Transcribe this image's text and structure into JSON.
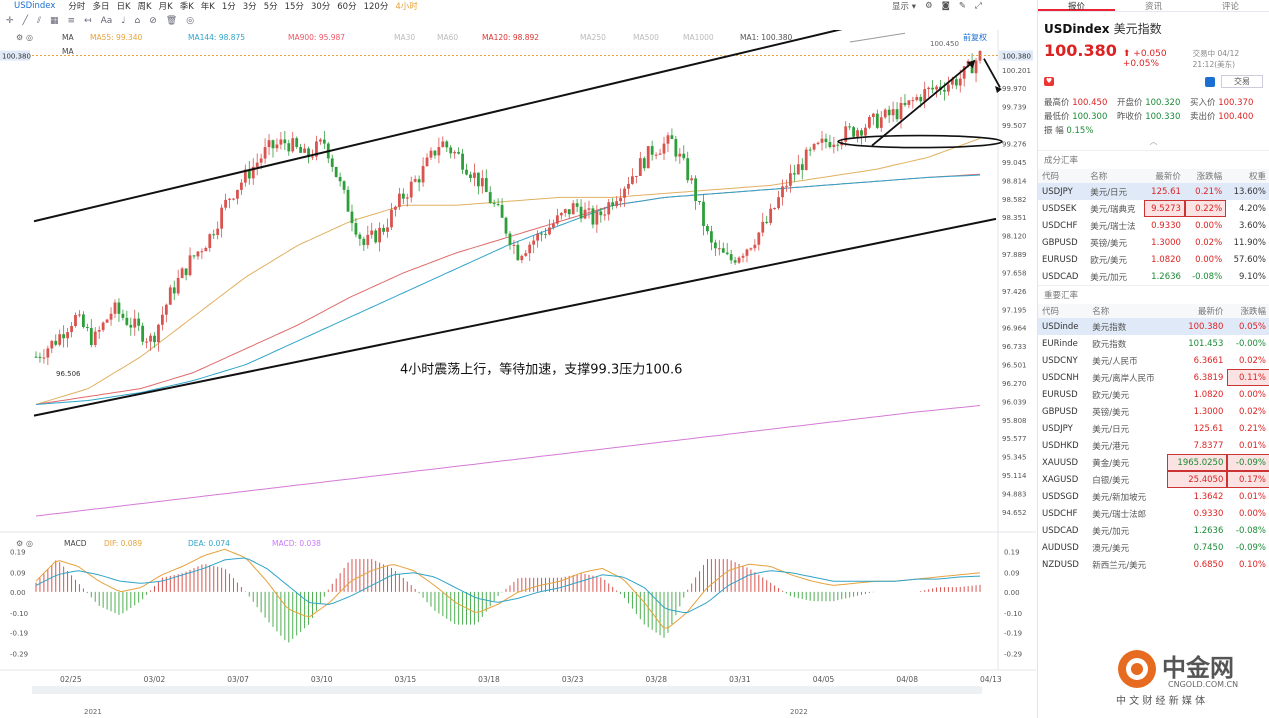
{
  "topbar": {
    "symbol": "USDindex",
    "intervals": [
      "分时",
      "多日",
      "日K",
      "周K",
      "月K",
      "季K",
      "年K",
      "1分",
      "3分",
      "5分",
      "15分",
      "30分",
      "60分",
      "120分",
      "4小时"
    ],
    "active": "4小时",
    "right": [
      "显示 ▾"
    ]
  },
  "ma_legend": {
    "label": "MA",
    "items": [
      {
        "name": "MA55: 99.340",
        "color": "#e6a23c"
      },
      {
        "name": "MA144: 98.875",
        "color": "#2fa4c9"
      },
      {
        "name": "MA900: 95.987",
        "color": "#e56"
      },
      {
        "name": "MA30",
        "color": "#bbb"
      },
      {
        "name": "MA60",
        "color": "#bbb"
      },
      {
        "name": "MA120: 98.892",
        "color": "#d33"
      },
      {
        "name": "MA250",
        "color": "#bbb"
      },
      {
        "name": "MA500",
        "color": "#bbb"
      },
      {
        "name": "MA1000",
        "color": "#bbb"
      },
      {
        "name": "MA1: 100.380",
        "color": "#555"
      }
    ],
    "restore": "前复权",
    "second_ma": "MA"
  },
  "macd_legend": {
    "label": "MACD",
    "items": [
      {
        "name": "DIF: 0.089",
        "color": "#e6a23c"
      },
      {
        "name": "DEA: 0.074",
        "color": "#2fa4c9"
      },
      {
        "name": "MACD: 0.038",
        "color": "#c7f"
      }
    ]
  },
  "annotation": "4小时震荡上行，等待加速，支撑99.3压力100.6",
  "chart_data": {
    "type": "candlestick",
    "y_ticks": [
      100.201,
      99.97,
      99.739,
      99.507,
      99.276,
      99.045,
      98.814,
      98.582,
      98.351,
      98.12,
      97.889,
      97.658,
      97.426,
      97.195,
      96.964,
      96.733,
      96.501,
      96.27,
      96.039,
      95.808,
      95.577,
      95.345,
      95.114,
      94.883,
      94.652
    ],
    "ylim": [
      94.55,
      100.55
    ],
    "last_price": 100.38,
    "high_label": 100.45,
    "low_label": 96.506,
    "x_ticks": [
      "02/25",
      "03/02",
      "03/07",
      "03/10",
      "03/15",
      "03/18",
      "03/23",
      "03/28",
      "03/31",
      "04/05",
      "04/08",
      "04/13"
    ],
    "close_path": [
      96.6,
      96.8,
      97.1,
      96.8,
      97.2,
      97.0,
      96.8,
      97.4,
      97.8,
      98.1,
      98.6,
      98.9,
      99.2,
      99.3,
      99.1,
      99.3,
      98.6,
      98.0,
      98.2,
      98.6,
      98.9,
      99.3,
      99.1,
      98.8,
      98.4,
      97.9,
      98.1,
      98.3,
      98.5,
      98.3,
      98.6,
      98.9,
      99.2,
      99.3,
      98.8,
      98.0,
      97.8,
      98.0,
      98.3,
      98.8,
      99.1,
      99.3,
      99.4,
      99.5,
      99.6,
      99.7,
      99.9,
      100.0,
      100.1,
      100.38
    ],
    "macd": {
      "ylim": [
        -0.32,
        0.22
      ],
      "y_ticks": [
        0.19,
        0.09,
        0.0,
        -0.1,
        -0.19,
        -0.29
      ],
      "dif": [
        0.05,
        0.15,
        0.12,
        0.05,
        0.0,
        0.02,
        0.08,
        0.12,
        0.17,
        0.2,
        0.16,
        0.05,
        -0.08,
        -0.12,
        -0.05,
        0.05,
        0.1,
        0.13,
        0.1,
        0.03,
        -0.05,
        -0.1,
        -0.06,
        0.0,
        0.03,
        0.05,
        0.09,
        0.11,
        0.06,
        -0.05,
        -0.18,
        -0.1,
        0.02,
        0.1,
        0.13,
        0.12,
        0.08,
        0.05,
        0.03,
        0.04,
        0.05,
        0.05,
        0.06,
        0.07,
        0.08,
        0.089
      ],
      "dea": [
        0.03,
        0.08,
        0.1,
        0.08,
        0.05,
        0.04,
        0.05,
        0.08,
        0.11,
        0.15,
        0.16,
        0.11,
        0.03,
        -0.05,
        -0.06,
        -0.02,
        0.03,
        0.08,
        0.09,
        0.07,
        0.02,
        -0.03,
        -0.05,
        -0.03,
        0.0,
        0.02,
        0.05,
        0.08,
        0.07,
        0.02,
        -0.08,
        -0.1,
        -0.05,
        0.03,
        0.08,
        0.1,
        0.09,
        0.07,
        0.05,
        0.05,
        0.05,
        0.05,
        0.06,
        0.06,
        0.07,
        0.074
      ]
    },
    "dates_bottom": [
      "2021",
      "2022"
    ]
  },
  "panel": {
    "tabs": [
      "报价",
      "资讯",
      "评论"
    ],
    "symbol": "USDindex",
    "name": "美元指数",
    "price": "100.380",
    "change": "+0.050",
    "pct": "+0.05%",
    "time": "交易中 04/12 21:12(美东)",
    "btn": "交易",
    "stats": [
      [
        "最高价",
        "100.450",
        "r"
      ],
      [
        "开盘价",
        "100.320",
        ""
      ],
      [
        "买入价",
        "100.370",
        "r"
      ],
      [
        "最低价",
        "100.300",
        ""
      ],
      [
        "昨收价",
        "100.330",
        ""
      ],
      [
        "卖出价",
        "100.400",
        "r"
      ],
      [
        "振 幅",
        "0.15%",
        ""
      ]
    ],
    "sec1": "成分汇率",
    "head1": [
      "代码",
      "名称",
      "最新价",
      "涨跌幅",
      "权重"
    ],
    "rows1": [
      [
        "USDJPY",
        "美元/日元",
        "125.61",
        "0.21%",
        "13.60%"
      ],
      [
        "USDSEK",
        "美元/瑞典克",
        "9.5273",
        "0.22%",
        "4.20%"
      ],
      [
        "USDCHF",
        "美元/瑞士法",
        "0.9330",
        "0.00%",
        "3.60%"
      ],
      [
        "GBPUSD",
        "英镑/美元",
        "1.3000",
        "0.02%",
        "11.90%"
      ],
      [
        "EURUSD",
        "欧元/美元",
        "1.0820",
        "0.00%",
        "57.60%"
      ],
      [
        "USDCAD",
        "美元/加元",
        "1.2636",
        "-0.08%",
        "9.10%"
      ]
    ],
    "sec2": "重要汇率",
    "head2": [
      "代码",
      "名称",
      "最新价",
      "涨跌幅"
    ],
    "rows2": [
      [
        "USDinde",
        "美元指数",
        "100.380",
        "0.05%"
      ],
      [
        "EURinde",
        "欧元指数",
        "101.453",
        "-0.00%"
      ],
      [
        "USDCNY",
        "美元/人民币",
        "6.3661",
        "0.02%"
      ],
      [
        "USDCNH",
        "美元/离岸人民币",
        "6.3819",
        "0.11%"
      ],
      [
        "EURUSD",
        "欧元/美元",
        "1.0820",
        "0.00%"
      ],
      [
        "GBPUSD",
        "英镑/美元",
        "1.3000",
        "0.02%"
      ],
      [
        "USDJPY",
        "美元/日元",
        "125.61",
        "0.21%"
      ],
      [
        "USDHKD",
        "美元/港元",
        "7.8377",
        "0.01%"
      ],
      [
        "XAUUSD",
        "黄金/美元",
        "1965.0250",
        "-0.09%"
      ],
      [
        "XAGUSD",
        "白银/美元",
        "25.4050",
        "0.17%"
      ],
      [
        "USDSGD",
        "美元/新加坡元",
        "1.3642",
        "0.01%"
      ],
      [
        "USDCHF",
        "美元/瑞士法郎",
        "0.9330",
        "0.00%"
      ],
      [
        "USDCAD",
        "美元/加元",
        "1.2636",
        "-0.08%"
      ],
      [
        "AUDUSD",
        "澳元/美元",
        "0.7450",
        "-0.09%"
      ],
      [
        "NZDUSD",
        "新西兰元/美元",
        "0.6850",
        "0.10%"
      ]
    ]
  },
  "watermark": {
    "cn": "中金网",
    "url": "CNGOLD.COM.CN",
    "slogan": "中 文 财 经 新 媒 体"
  }
}
